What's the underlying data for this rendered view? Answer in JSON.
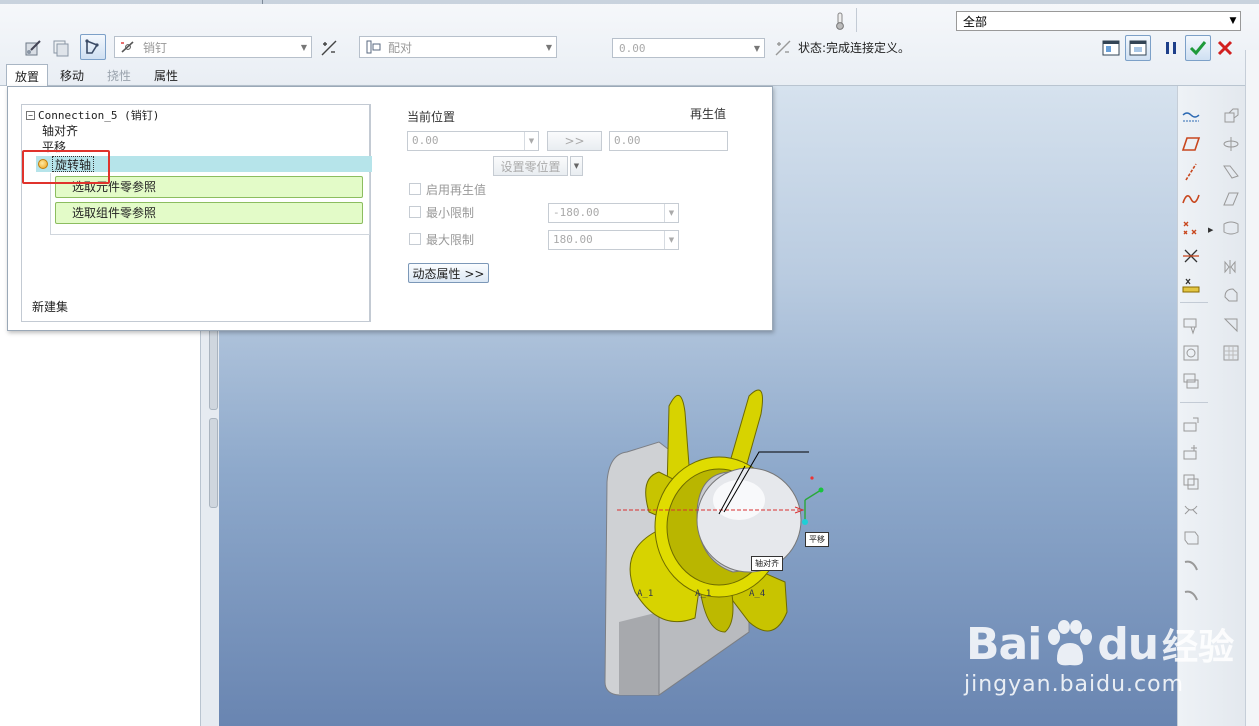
{
  "toolbar": {
    "constraint_type": "销钉",
    "constraint_relation": "配对",
    "offset_value": "0.00",
    "status_text": "状态:完成连接定义。",
    "filter_value": "全部"
  },
  "tabs": [
    {
      "label": "放置",
      "state": "active"
    },
    {
      "label": "移动",
      "state": "normal"
    },
    {
      "label": "挠性",
      "state": "disabled"
    },
    {
      "label": "属性",
      "state": "normal"
    }
  ],
  "placement": {
    "root": "Connection_5 (销钉)",
    "items": [
      "轴对齐",
      "平移",
      "旋转轴"
    ],
    "selected": "旋转轴",
    "refs": [
      "选取元件零参照",
      "选取组件零参照"
    ],
    "new_set": "新建集",
    "current_position_label": "当前位置",
    "current_position_value": "0.00",
    "regen_label": "再生值",
    "regen_value": "0.00",
    "arrow_btn": ">>",
    "set_zero_btn": "设置零位置",
    "enable_regen": "启用再生值",
    "min_limit": "最小限制",
    "min_value": "-180.00",
    "max_limit": "最大限制",
    "max_value": "180.00",
    "dynamic_btn": "动态属性 >>"
  },
  "model": {
    "callout_translate": "平移",
    "callout_axis": "轴对齐",
    "axis_labels": [
      "A_1",
      "A_1",
      "A_4"
    ]
  },
  "watermark": {
    "brand_a": "Bai",
    "brand_b": "du",
    "brand_cn": "经验",
    "url": "jingyan.baidu.com"
  },
  "colors": {
    "selection_row": "#b6e4ea",
    "reference_box": "#e3fbc8",
    "highlight_box": "#e0332c",
    "fan_yellow": "#d7d300",
    "confirm_green": "#1e9a3a",
    "cancel_red": "#d21f1f"
  }
}
